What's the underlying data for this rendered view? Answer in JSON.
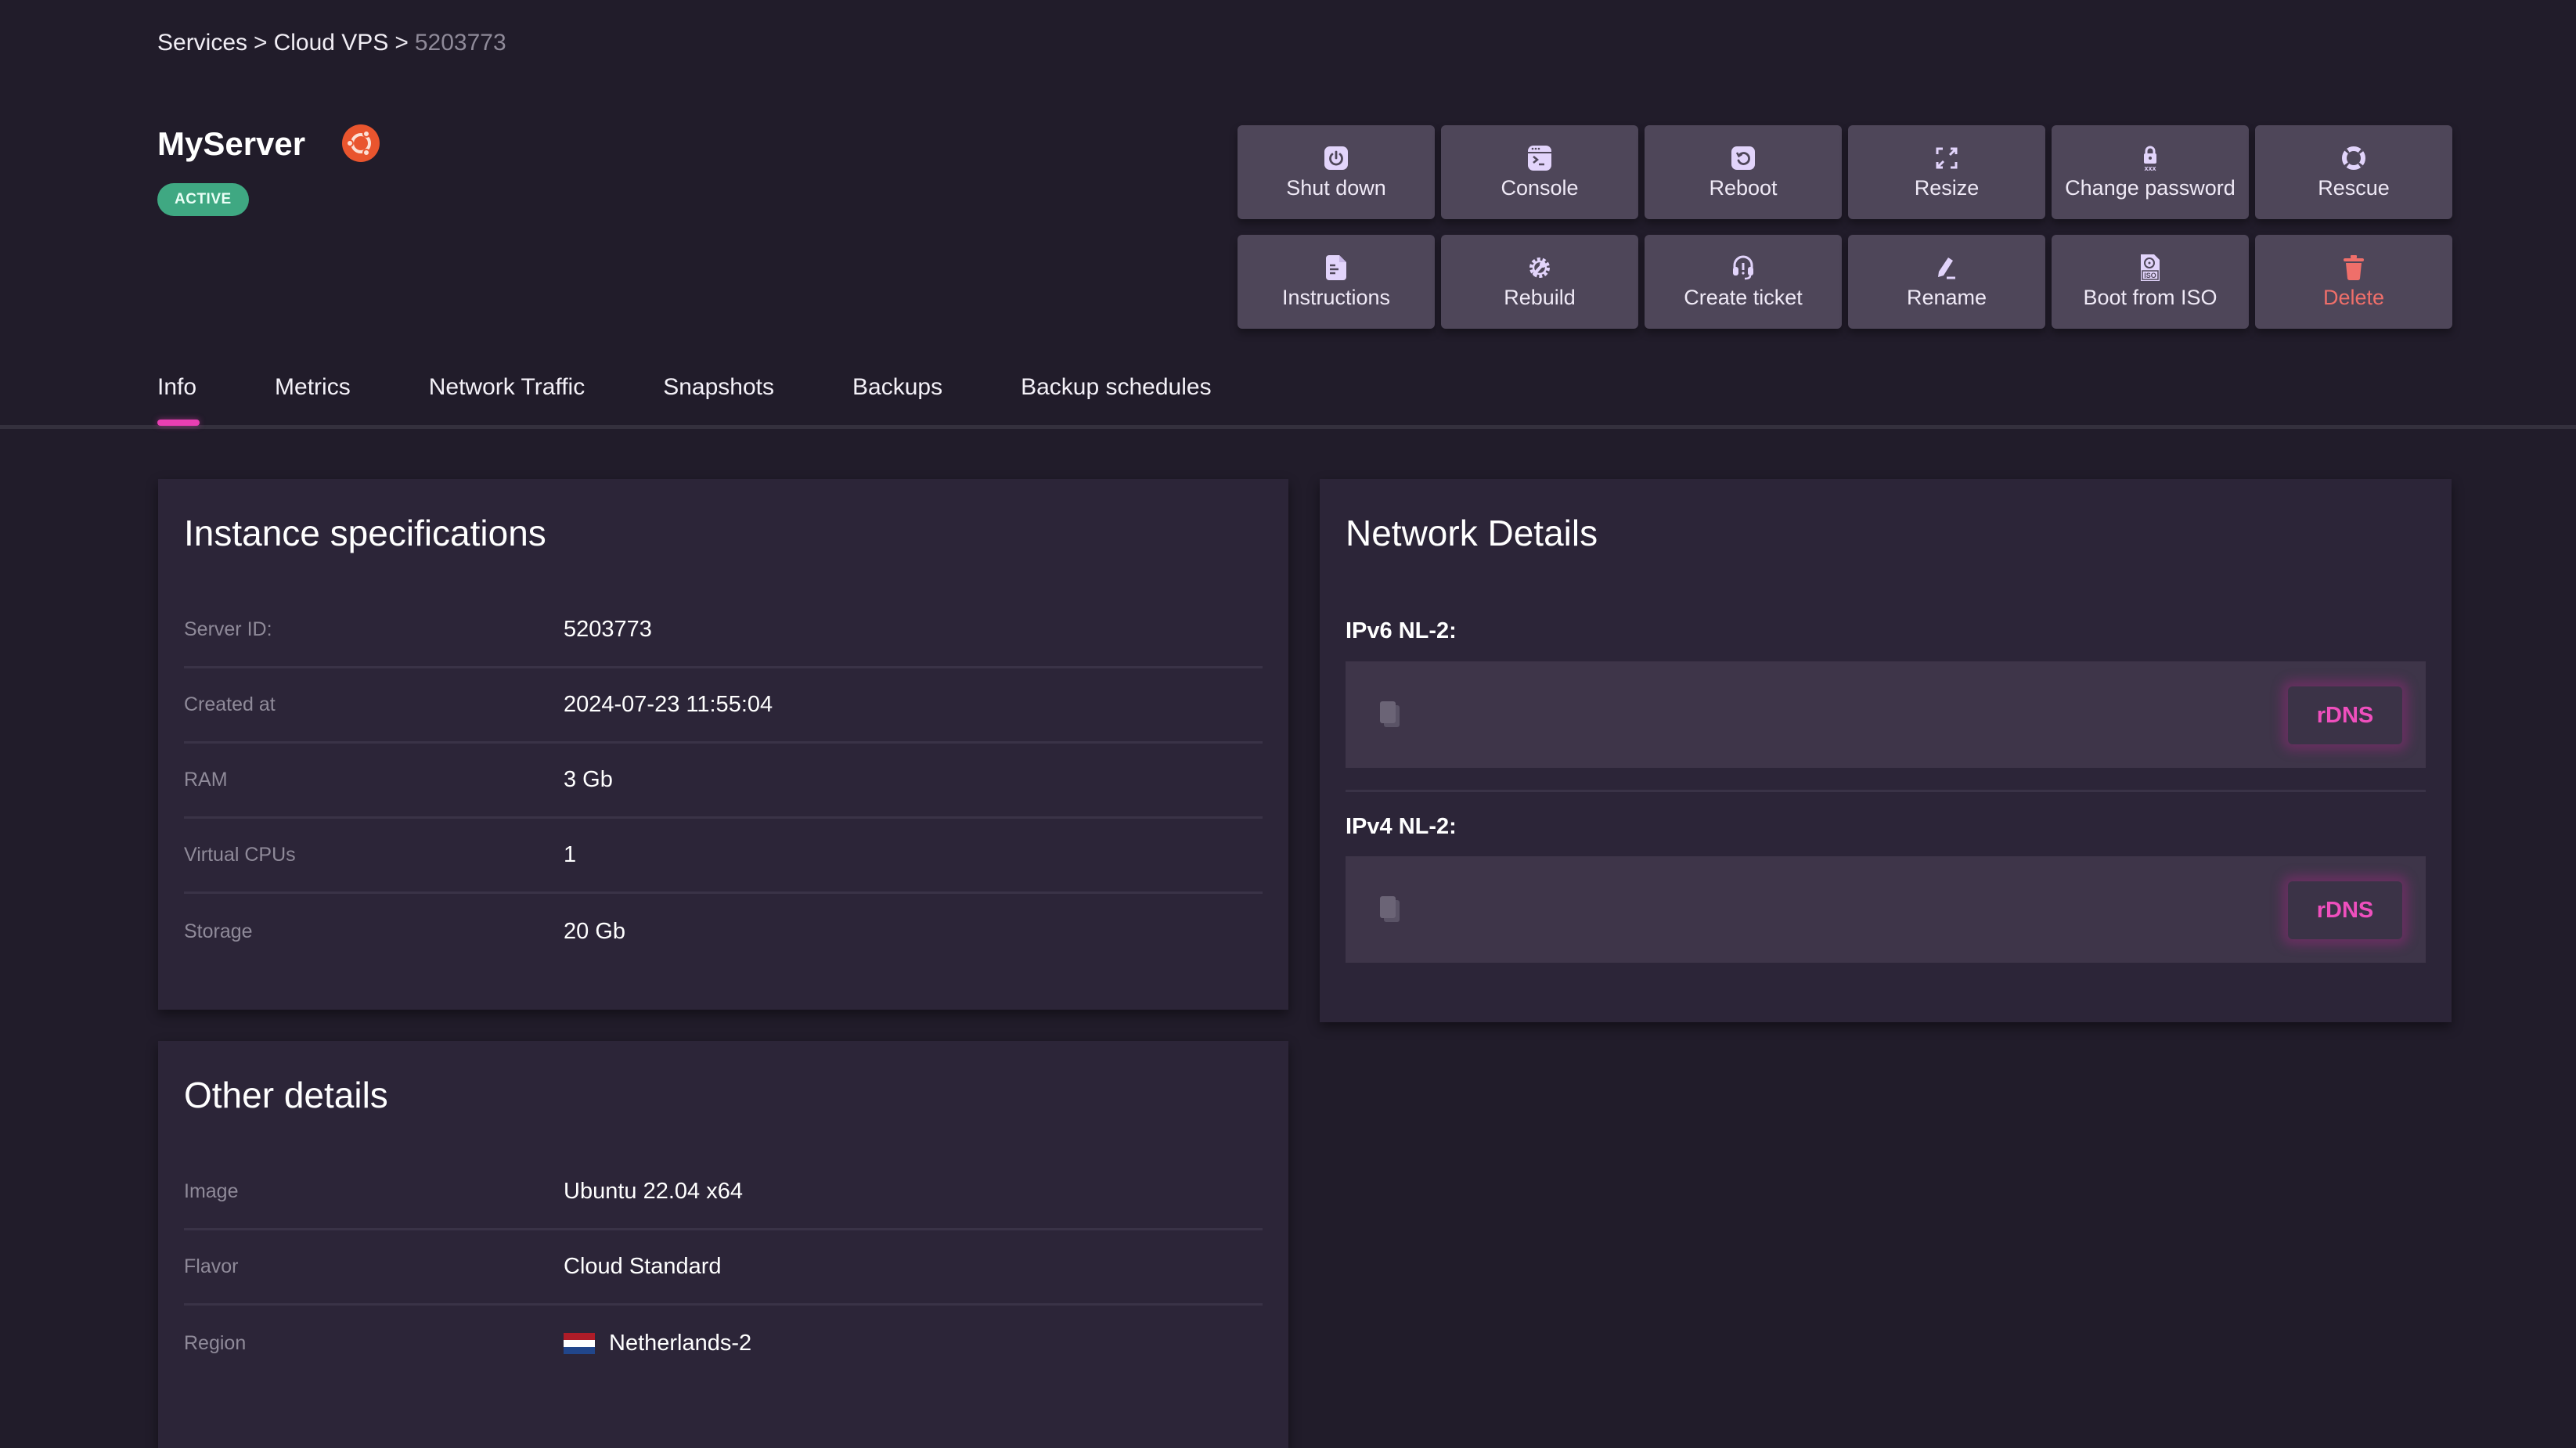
{
  "breadcrumb": {
    "items": [
      "Services",
      "Cloud VPS"
    ],
    "separator": ">",
    "current": "5203773"
  },
  "server": {
    "name": "MyServer",
    "os_icon": "ubuntu-logo-icon",
    "status": "ACTIVE"
  },
  "colors": {
    "accent": "#e93fb3",
    "status_active": "#3fa882",
    "danger": "#ef6f6a",
    "icon_fill": "#e2d4fb",
    "ubuntu": "#e9552e"
  },
  "actions": [
    {
      "label": "Shut down",
      "icon": "power-icon"
    },
    {
      "label": "Console",
      "icon": "terminal-icon"
    },
    {
      "label": "Reboot",
      "icon": "reboot-icon"
    },
    {
      "label": "Resize",
      "icon": "resize-icon"
    },
    {
      "label": "Change password",
      "icon": "lock-password-icon"
    },
    {
      "label": "Rescue",
      "icon": "lifebuoy-icon"
    },
    {
      "label": "Instructions",
      "icon": "document-icon"
    },
    {
      "label": "Rebuild",
      "icon": "gear-wrench-icon"
    },
    {
      "label": "Create ticket",
      "icon": "headset-icon"
    },
    {
      "label": "Rename",
      "icon": "pencil-icon"
    },
    {
      "label": "Boot from ISO",
      "icon": "iso-file-icon"
    },
    {
      "label": "Delete",
      "icon": "trash-icon"
    }
  ],
  "tabs": [
    {
      "label": "Info",
      "active": true
    },
    {
      "label": "Metrics"
    },
    {
      "label": "Network Traffic"
    },
    {
      "label": "Snapshots"
    },
    {
      "label": "Backups"
    },
    {
      "label": "Backup schedules"
    }
  ],
  "instance_specs": {
    "title": "Instance specifications",
    "rows": [
      {
        "label": "Server ID:",
        "value": "5203773"
      },
      {
        "label": "Created at",
        "value": "2024-07-23 11:55:04"
      },
      {
        "label": "RAM",
        "value": "3 Gb"
      },
      {
        "label": "Virtual CPUs",
        "value": "1"
      },
      {
        "label": "Storage",
        "value": "20 Gb"
      }
    ]
  },
  "other_details": {
    "title": "Other details",
    "rows": [
      {
        "label": "Image",
        "value": "Ubuntu 22.04 x64"
      },
      {
        "label": "Flavor",
        "value": "Cloud Standard"
      },
      {
        "label": "Region",
        "value": "Netherlands-2",
        "flag": "netherlands-flag-icon"
      }
    ]
  },
  "network": {
    "title": "Network Details",
    "entries": [
      {
        "label": "IPv6 NL-2:",
        "value": "",
        "rdns_label": "rDNS"
      },
      {
        "label": "IPv4 NL-2:",
        "value": "",
        "rdns_label": "rDNS"
      }
    ]
  }
}
